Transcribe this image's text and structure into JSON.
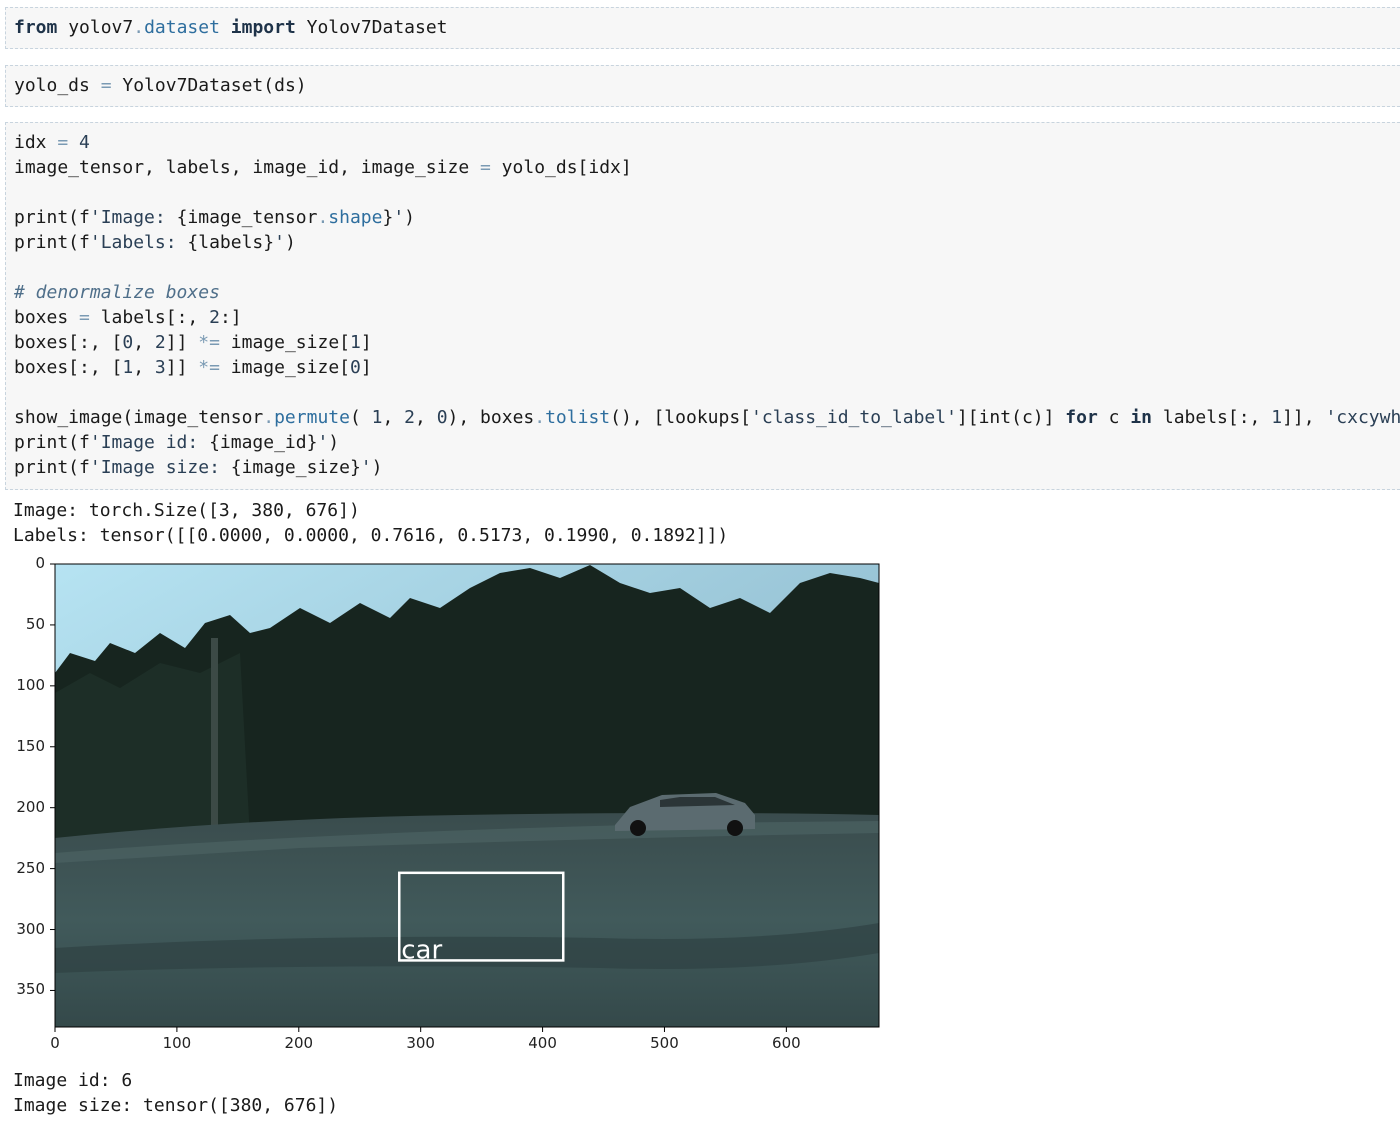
{
  "cells": [
    {
      "lines": [
        [
          {
            "t": "from",
            "c": "kw"
          },
          {
            "t": " yolov7"
          },
          {
            "t": ".",
            "c": "op"
          },
          {
            "t": "dataset",
            "c": "attr"
          },
          {
            "t": " "
          },
          {
            "t": "import",
            "c": "kw"
          },
          {
            "t": " Yolov7Dataset"
          }
        ]
      ]
    },
    {
      "lines": [
        [
          {
            "t": "yolo_ds "
          },
          {
            "t": "=",
            "c": "op"
          },
          {
            "t": " Yolov7Dataset(ds)"
          }
        ]
      ]
    },
    {
      "lines": [
        [
          {
            "t": "idx "
          },
          {
            "t": "=",
            "c": "op"
          },
          {
            "t": " "
          },
          {
            "t": "4",
            "c": "num"
          }
        ],
        [
          {
            "t": "image_tensor, labels, image_id, image_size "
          },
          {
            "t": "=",
            "c": "op"
          },
          {
            "t": " yolo_ds[idx]"
          }
        ],
        [],
        [
          {
            "t": "print(f"
          },
          {
            "t": "'Image: ",
            "c": "str"
          },
          {
            "t": "{image_tensor"
          },
          {
            "t": ".",
            "c": "op"
          },
          {
            "t": "shape",
            "c": "attr"
          },
          {
            "t": "}"
          },
          {
            "t": "'",
            "c": "str"
          },
          {
            "t": ")"
          }
        ],
        [
          {
            "t": "print(f"
          },
          {
            "t": "'Labels: ",
            "c": "str"
          },
          {
            "t": "{labels}"
          },
          {
            "t": "'",
            "c": "str"
          },
          {
            "t": ")"
          }
        ],
        [],
        [
          {
            "t": "# denormalize boxes",
            "c": "cm"
          }
        ],
        [
          {
            "t": "boxes "
          },
          {
            "t": "=",
            "c": "op"
          },
          {
            "t": " labels[:, "
          },
          {
            "t": "2",
            "c": "num"
          },
          {
            "t": ":]"
          }
        ],
        [
          {
            "t": "boxes[:, ["
          },
          {
            "t": "0",
            "c": "num"
          },
          {
            "t": ", "
          },
          {
            "t": "2",
            "c": "num"
          },
          {
            "t": "]] "
          },
          {
            "t": "*=",
            "c": "op"
          },
          {
            "t": " image_size["
          },
          {
            "t": "1",
            "c": "num"
          },
          {
            "t": "]"
          }
        ],
        [
          {
            "t": "boxes[:, ["
          },
          {
            "t": "1",
            "c": "num"
          },
          {
            "t": ", "
          },
          {
            "t": "3",
            "c": "num"
          },
          {
            "t": "]] "
          },
          {
            "t": "*=",
            "c": "op"
          },
          {
            "t": " image_size["
          },
          {
            "t": "0",
            "c": "num"
          },
          {
            "t": "]"
          }
        ],
        [],
        [
          {
            "t": "show_image(image_tensor"
          },
          {
            "t": ".",
            "c": "op"
          },
          {
            "t": "permute",
            "c": "attr"
          },
          {
            "t": "( "
          },
          {
            "t": "1",
            "c": "num"
          },
          {
            "t": ", "
          },
          {
            "t": "2",
            "c": "num"
          },
          {
            "t": ", "
          },
          {
            "t": "0",
            "c": "num"
          },
          {
            "t": "), boxes"
          },
          {
            "t": ".",
            "c": "op"
          },
          {
            "t": "tolist",
            "c": "attr"
          },
          {
            "t": "(), [lookups["
          },
          {
            "t": "'class_id_to_label'",
            "c": "str"
          },
          {
            "t": "][int(c)] "
          },
          {
            "t": "for",
            "c": "kw"
          },
          {
            "t": " c "
          },
          {
            "t": "in",
            "c": "kw"
          },
          {
            "t": " labels[:, "
          },
          {
            "t": "1",
            "c": "num"
          },
          {
            "t": "]], "
          },
          {
            "t": "'cxcywh'",
            "c": "str"
          },
          {
            "t": ")"
          }
        ],
        [
          {
            "t": "print(f"
          },
          {
            "t": "'Image id: ",
            "c": "str"
          },
          {
            "t": "{image_id}"
          },
          {
            "t": "'",
            "c": "str"
          },
          {
            "t": ")"
          }
        ],
        [
          {
            "t": "print(f"
          },
          {
            "t": "'Image size: ",
            "c": "str"
          },
          {
            "t": "{image_size}"
          },
          {
            "t": "'",
            "c": "str"
          },
          {
            "t": ")"
          }
        ]
      ]
    }
  ],
  "output": {
    "line_image_shape": "Image: torch.Size([3, 380, 676])",
    "line_labels": "Labels: tensor([[0.0000, 0.0000, 0.7616, 0.5173, 0.1990, 0.1892]])",
    "line_image_id": "Image id: 6",
    "line_image_size": "Image size: tensor([380, 676])"
  },
  "plot": {
    "image_width": 676,
    "image_height": 380,
    "y_ticks": [
      "0",
      "50",
      "100",
      "150",
      "200",
      "250",
      "300",
      "350"
    ],
    "x_ticks": [
      "0",
      "100",
      "200",
      "300",
      "400",
      "500",
      "600"
    ],
    "y_tick_values": [
      0,
      50,
      100,
      150,
      200,
      250,
      300,
      350
    ],
    "x_tick_values": [
      0,
      100,
      200,
      300,
      400,
      500,
      600
    ],
    "box": {
      "cx": 0.5173,
      "cy": 0.7616,
      "w": 0.199,
      "h": 0.1892
    },
    "box_label": "car",
    "box_color": "#ffffff",
    "sky_color": "#a9d4e6",
    "trees_color": "#17251f",
    "road_color": "#3e5456"
  }
}
